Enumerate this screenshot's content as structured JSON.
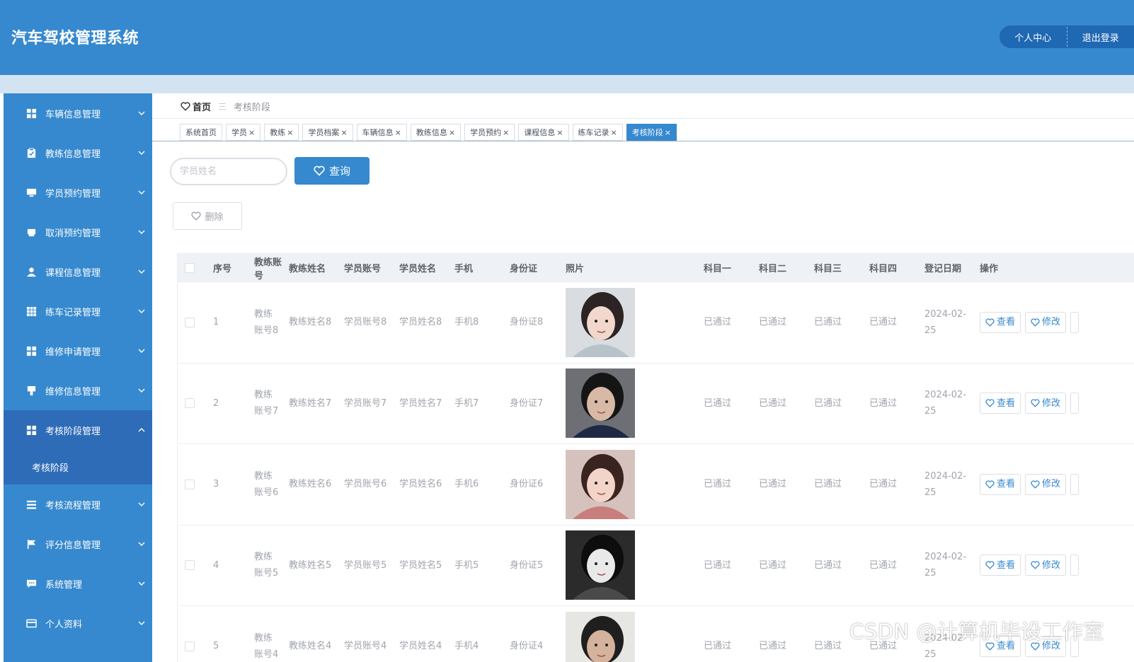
{
  "header": {
    "title": "汽车驾校管理系统",
    "personal_center": "个人中心",
    "logout": "退出登录"
  },
  "sidebar": {
    "items": [
      {
        "label": "车辆信息管理",
        "icon": "grid-icon"
      },
      {
        "label": "教练信息管理",
        "icon": "clipboard-icon"
      },
      {
        "label": "学员预约管理",
        "icon": "monitor-icon"
      },
      {
        "label": "取消预约管理",
        "icon": "printer-icon"
      },
      {
        "label": "课程信息管理",
        "icon": "user-icon"
      },
      {
        "label": "练车记录管理",
        "icon": "grid9-icon"
      },
      {
        "label": "维修申请管理",
        "icon": "grid-icon"
      },
      {
        "label": "维修信息管理",
        "icon": "brush-icon"
      },
      {
        "label": "考核阶段管理",
        "icon": "grid-icon",
        "open": true
      },
      {
        "label": "考核流程管理",
        "icon": "list-icon"
      },
      {
        "label": "评分信息管理",
        "icon": "flag-icon"
      },
      {
        "label": "系统管理",
        "icon": "chat-icon"
      },
      {
        "label": "个人资料",
        "icon": "card-icon"
      }
    ],
    "submenu_label": "考核阶段"
  },
  "breadcrumb": {
    "home": "首页",
    "separator": "三",
    "current": "考核阶段"
  },
  "tabs": [
    {
      "label": "系统首页",
      "closable": false
    },
    {
      "label": "学员",
      "closable": true
    },
    {
      "label": "教练",
      "closable": true
    },
    {
      "label": "学员档案",
      "closable": true
    },
    {
      "label": "车辆信息",
      "closable": true
    },
    {
      "label": "教练信息",
      "closable": true
    },
    {
      "label": "学员预约",
      "closable": true
    },
    {
      "label": "课程信息",
      "closable": true
    },
    {
      "label": "练车记录",
      "closable": true
    },
    {
      "label": "考核阶段",
      "closable": true,
      "active": true
    }
  ],
  "search": {
    "placeholder": "学员姓名",
    "query_label": "查询",
    "delete_label": "删除"
  },
  "table": {
    "columns": [
      "序号",
      "教练账号",
      "教练姓名",
      "学员账号",
      "学员姓名",
      "手机",
      "身份证",
      "照片",
      "科目一",
      "科目二",
      "科目三",
      "科目四",
      "登记日期",
      "操作"
    ],
    "rows": [
      {
        "no": "1",
        "coach_account": "教练账号8",
        "coach_name": "教练姓名8",
        "student_account": "学员账号8",
        "student_name": "学员姓名8",
        "phone": "手机8",
        "id_card": "身份证8",
        "photo": "photo-girl-1",
        "s1": "已通过",
        "s2": "已通过",
        "s3": "已通过",
        "s4": "已通过",
        "date": "2024-02-25"
      },
      {
        "no": "2",
        "coach_account": "教练账号7",
        "coach_name": "教练姓名7",
        "student_account": "学员账号7",
        "student_name": "学员姓名7",
        "phone": "手机7",
        "id_card": "身份证7",
        "photo": "photo-boy-cap",
        "s1": "已通过",
        "s2": "已通过",
        "s3": "已通过",
        "s4": "已通过",
        "date": "2024-02-25"
      },
      {
        "no": "3",
        "coach_account": "教练账号6",
        "coach_name": "教练姓名6",
        "student_account": "学员账号6",
        "student_name": "学员姓名6",
        "phone": "手机6",
        "id_card": "身份证6",
        "photo": "photo-girl-2",
        "s1": "已通过",
        "s2": "已通过",
        "s3": "已通过",
        "s4": "已通过",
        "date": "2024-02-25"
      },
      {
        "no": "4",
        "coach_account": "教练账号5",
        "coach_name": "教练姓名5",
        "student_account": "学员账号5",
        "student_name": "学员姓名5",
        "phone": "手机5",
        "id_card": "身份证5",
        "photo": "photo-anime",
        "s1": "已通过",
        "s2": "已通过",
        "s3": "已通过",
        "s4": "已通过",
        "date": "2024-02-25"
      },
      {
        "no": "5",
        "coach_account": "教练账号4",
        "coach_name": "教练姓名4",
        "student_account": "学员账号4",
        "student_name": "学员姓名4",
        "phone": "手机4",
        "id_card": "身份证4",
        "photo": "photo-boy-2",
        "s1": "已通过",
        "s2": "已通过",
        "s3": "已通过",
        "s4": "已通过",
        "date": "2024-02-25"
      }
    ],
    "view_label": "查看",
    "edit_label": "修改"
  },
  "watermark": "CSDN @计算机毕设工作室",
  "colors": {
    "primary": "#3689cf",
    "sidebar_open": "#2f6cb7",
    "header_tab": "#1f68b3"
  }
}
